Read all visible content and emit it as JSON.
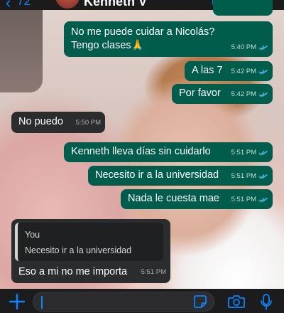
{
  "header": {
    "back_count": "72",
    "contact_name": "Kenneth V"
  },
  "colors": {
    "outgoing_bubble": "#005c4b",
    "incoming_bubble": "#2a2c2e",
    "read_ticks": "#53bdeb",
    "accent": "#0a84ff"
  },
  "messages": [
    {
      "direction": "out",
      "text": "No me puede cuidar a Nicolás? Tengo clases🙏",
      "time": "5:40 PM",
      "status": "read"
    },
    {
      "direction": "out",
      "text": "A las 7",
      "time": "5:42 PM",
      "status": "read"
    },
    {
      "direction": "out",
      "text": "Por favor",
      "time": "5:42 PM",
      "status": "read"
    },
    {
      "direction": "in",
      "text": "No puedo",
      "time": "5:50 PM"
    },
    {
      "direction": "out",
      "text": "Kenneth lleva días sin cuidarlo",
      "time": "5:51 PM",
      "status": "read"
    },
    {
      "direction": "out",
      "text": "Necesito ir a la universidad",
      "time": "5:51 PM",
      "status": "read"
    },
    {
      "direction": "out",
      "text": "Nada le cuesta mae",
      "time": "5:51 PM",
      "status": "read"
    },
    {
      "direction": "in",
      "text": "Eso a mi no me importa",
      "time": "5:51 PM",
      "quote": {
        "author": "You",
        "text": "Necesito ir a la universidad"
      }
    }
  ],
  "composer": {
    "placeholder": ""
  },
  "icons": [
    "back-icon",
    "video-call-icon",
    "phone-icon",
    "plus-icon",
    "sticker-icon",
    "camera-icon",
    "mic-icon",
    "read-ticks-icon"
  ]
}
